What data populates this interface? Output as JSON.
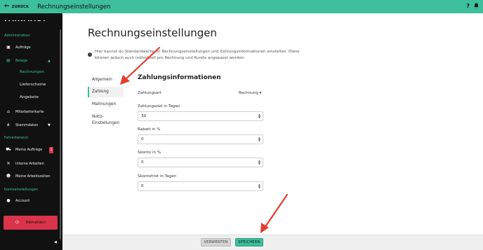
{
  "topbar": {
    "back_label": "ZURÜCK",
    "title": "Rechnungseinstellungen",
    "help_glyph": "?",
    "bell_glyph": "🔔"
  },
  "sidebar": {
    "logo": "FAIRMACT",
    "sections": {
      "admin": "Administration",
      "fahrer": "Fahrerbereich",
      "konto": "Kontoeinstellungen"
    },
    "items": {
      "auftraege": "Aufträge",
      "belege": "Belege",
      "rechnungen": "Rechnungen",
      "lieferscheine": "Lieferscheine",
      "angebote": "Angebote",
      "mitarbeiterkarte": "Mitarbeiterkarte",
      "stammdaten": "Stammdaten",
      "meine_auftraege": "Meine Aufträge",
      "interne_arbeiten": "Interne Arbeiten",
      "meine_arbeitszeiten": "Meine Arbeitszeiten",
      "account": "Account"
    },
    "badge_count": "1",
    "logout_label": "Abmelden"
  },
  "main": {
    "title": "Rechnungseinstellungen",
    "info_text": "Hier kannst du Standardwerte für Rechnungseinstellungen und Zahlungsinformationen einstellen. Diese können jedoch auch individuell pro Rechnung und Kunde angepasst werden.",
    "tabs": [
      "Allgemein",
      "Zahlung",
      "Mahnungen",
      "Notiz-Einstellungen"
    ],
    "active_tab": "Zahlung",
    "section_title": "Zahlungsinformationen",
    "fields": {
      "zahlungsart_label": "Zahlungsart",
      "zahlungsart_value": "Rechnung ▾",
      "zahlungsziel_label": "Zahlungsziel in Tagen",
      "zahlungsziel_value": "30",
      "rabatt_label": "Rabatt in %",
      "rabatt_value": "0",
      "skonto_label": "Skonto in %",
      "skonto_value": "0",
      "skontofrist_label": "Skontofrist in Tagen",
      "skontofrist_value": "0"
    }
  },
  "footer": {
    "discard_label": "VERWERFEN",
    "save_label": "SPEICHERN"
  },
  "colors": {
    "accent": "#3dbf9b",
    "danger": "#d9344a",
    "sidebar_bg": "#111111",
    "annotation_arrow": "#e53b2c"
  }
}
